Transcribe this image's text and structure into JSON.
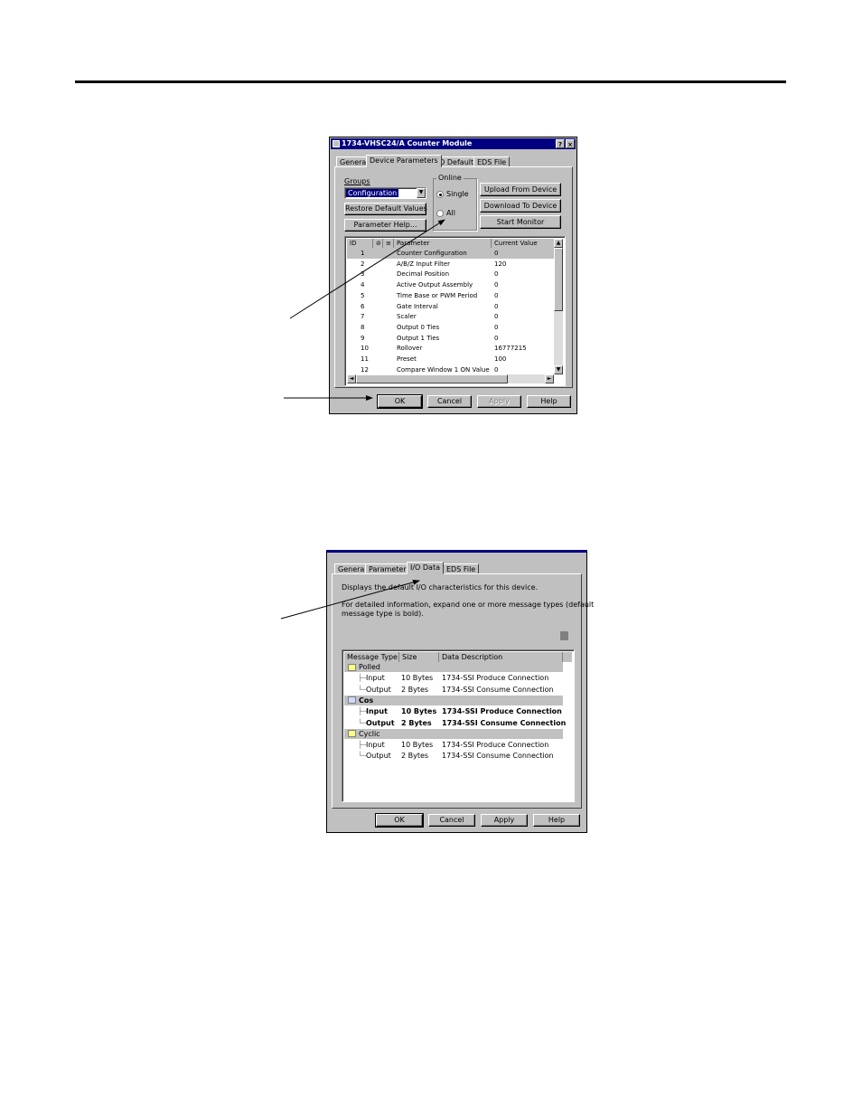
{
  "dialog1": {
    "title": "1734-VHSC24/A Counter Module",
    "tabs": [
      "General",
      "Device Parameters",
      "I/O Defaults",
      "EDS File"
    ],
    "groups_label": "Groups",
    "groups_value": "Configuration",
    "restore_label": "Restore Default Values",
    "param_help_label": "Parameter Help...",
    "online_label": "Online",
    "single_label": "Single",
    "all_label": "All",
    "upload_label": "Upload From Device",
    "download_label": "Download To Device",
    "monitor_label": "Start Monitor",
    "columns": [
      "ID",
      "",
      "",
      "Parameter",
      "Current Value"
    ],
    "rows": [
      {
        "id": "1",
        "name": "Counter Configuration",
        "value": "0"
      },
      {
        "id": "2",
        "name": "A/B/Z Input Filter",
        "value": "120"
      },
      {
        "id": "3",
        "name": "Decimal Position",
        "value": "0"
      },
      {
        "id": "4",
        "name": "Active Output Assembly",
        "value": "0"
      },
      {
        "id": "5",
        "name": "Time Base or PWM Period",
        "value": "0"
      },
      {
        "id": "6",
        "name": "Gate Interval",
        "value": "0"
      },
      {
        "id": "7",
        "name": "Scaler",
        "value": "0"
      },
      {
        "id": "8",
        "name": "Output 0 Ties",
        "value": "0"
      },
      {
        "id": "9",
        "name": "Output 1 Ties",
        "value": "0"
      },
      {
        "id": "10",
        "name": "Rollover",
        "value": "16777215"
      },
      {
        "id": "11",
        "name": "Preset",
        "value": "100"
      },
      {
        "id": "12",
        "name": "Compare Window 1 ON Value",
        "value": "0"
      }
    ],
    "ok_label": "OK",
    "cancel_label": "Cancel",
    "apply_label": "Apply",
    "help_label": "Help"
  },
  "dialog2": {
    "tabs": [
      "General",
      "Parameters",
      "I/O Data",
      "EDS File"
    ],
    "desc1": "Displays the default I/O characteristics for this device.",
    "desc2a": "For detailed information, expand one or more message types (default",
    "desc2b": "message type is bold).",
    "columns": [
      "Message Type",
      "Size",
      "Data Description"
    ],
    "groups": [
      {
        "name": "Polled",
        "bold": false,
        "rows": [
          {
            "type": "Input",
            "size": "10 Bytes",
            "desc": "1734-SSI Produce Connection"
          },
          {
            "type": "Output",
            "size": "2 Bytes",
            "desc": "1734-SSI Consume Connection"
          }
        ]
      },
      {
        "name": "Cos",
        "bold": true,
        "rows": [
          {
            "type": "Input",
            "size": "10 Bytes",
            "desc": "1734-SSI Produce Connection"
          },
          {
            "type": "Output",
            "size": "2 Bytes",
            "desc": "1734-SSI Consume Connection"
          }
        ]
      },
      {
        "name": "Cyclic",
        "bold": false,
        "rows": [
          {
            "type": "Input",
            "size": "10 Bytes",
            "desc": "1734-SSI Produce Connection"
          },
          {
            "type": "Output",
            "size": "2 Bytes",
            "desc": "1734-SSI Consume Connection"
          }
        ]
      }
    ],
    "ok_label": "OK",
    "cancel_label": "Cancel",
    "apply_label": "Apply",
    "help_label": "Help"
  }
}
